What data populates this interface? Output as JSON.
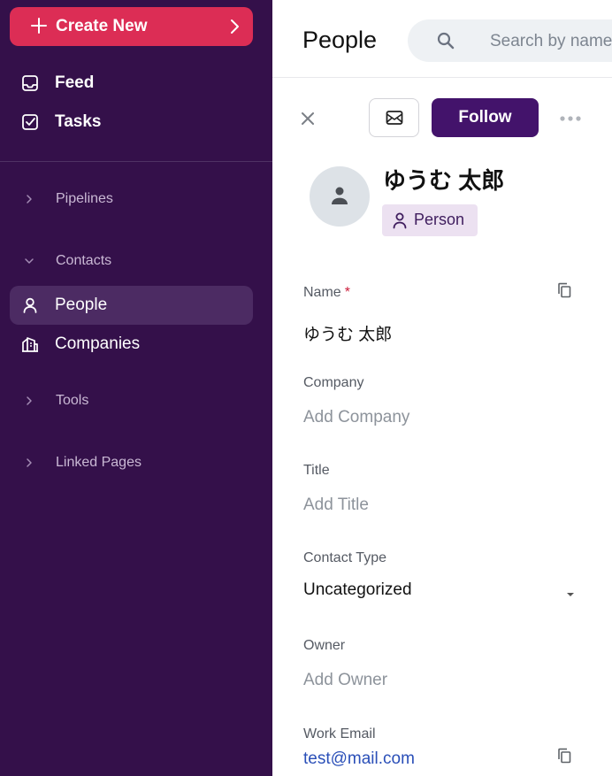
{
  "sidebar": {
    "create_label": "Create New",
    "items": [
      {
        "label": "Feed"
      },
      {
        "label": "Tasks"
      }
    ],
    "sections": {
      "pipelines": "Pipelines",
      "contacts": "Contacts",
      "tools": "Tools",
      "linked_pages": "Linked Pages"
    },
    "contacts_items": [
      {
        "label": "People"
      },
      {
        "label": "Companies"
      }
    ]
  },
  "header": {
    "title": "People",
    "search_placeholder": "Search by name"
  },
  "record": {
    "follow_label": "Follow",
    "name": "ゆうむ 太郎",
    "type_badge": "Person",
    "fields": {
      "name": {
        "label": "Name",
        "required": "*",
        "value": "ゆうむ 太郎"
      },
      "company": {
        "label": "Company",
        "value": "Add Company"
      },
      "title": {
        "label": "Title",
        "value": "Add Title"
      },
      "contact_type": {
        "label": "Contact Type",
        "value": "Uncategorized"
      },
      "owner": {
        "label": "Owner",
        "value": "Add Owner"
      },
      "work_email": {
        "label": "Work Email",
        "value": "test@mail.com"
      }
    }
  },
  "colors": {
    "sidebar_bg": "#34104a",
    "create_button": "#dc2d55",
    "follow_button": "#43136b",
    "active_item": "#4c2b63",
    "link": "#2a4fb8"
  }
}
